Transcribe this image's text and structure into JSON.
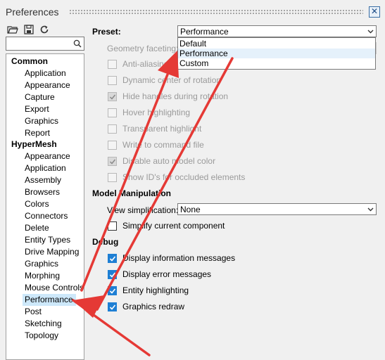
{
  "window": {
    "title": "Preferences",
    "close": "✕"
  },
  "toolbar": {
    "icons": [
      "open-folder-icon",
      "save-icon",
      "refresh-icon"
    ]
  },
  "search": {
    "value": "",
    "icon": "search-icon"
  },
  "tree": {
    "groups": [
      {
        "label": "Common",
        "items": [
          "Application",
          "Appearance",
          "Capture",
          "Export",
          "Graphics",
          "Report"
        ]
      },
      {
        "label": "HyperMesh",
        "items": [
          "Appearance",
          "Application",
          "Assembly",
          "Browsers",
          "Colors",
          "Connectors",
          "Delete",
          "Entity Types",
          "Drive Mapping",
          "Graphics",
          "Morphing",
          "Mouse Controls",
          "Performance",
          "Post",
          "Sketching",
          "Topology"
        ]
      }
    ],
    "selected": "Performance"
  },
  "preset": {
    "label": "Preset:",
    "value": "Performance",
    "options": [
      "Default",
      "Performance",
      "Custom"
    ],
    "highlighted": "Performance"
  },
  "geometry_faceting": {
    "label": "Geometry faceting:"
  },
  "performance_options": [
    {
      "label": "Anti-aliasing",
      "checked": false
    },
    {
      "label": "Dynamic center of rotation",
      "checked": false
    },
    {
      "label": "Hide handles during rotation",
      "checked": true
    },
    {
      "label": "Hover highlighting",
      "checked": false
    },
    {
      "label": "Transparent highlight",
      "checked": false
    },
    {
      "label": "Write to command file",
      "checked": false
    },
    {
      "label": "Disable auto model color",
      "checked": true
    },
    {
      "label": "Show ID's for occluded elements",
      "checked": false
    }
  ],
  "model_manipulation": {
    "header": "Model Manipulation",
    "view_simplification_label": "View simplification:",
    "view_simplification_value": "None",
    "simplify_label": "Simplify current component",
    "simplify_checked": false
  },
  "debug": {
    "header": "Debug",
    "options": [
      {
        "label": "Display information messages",
        "checked": true
      },
      {
        "label": "Display error messages",
        "checked": true
      },
      {
        "label": "Entity highlighting",
        "checked": true
      },
      {
        "label": "Graphics redraw",
        "checked": true
      }
    ]
  },
  "colors": {
    "accent": "#1e7fd4",
    "selection": "#cde8fa",
    "annotation_arrow": "#e53935"
  }
}
